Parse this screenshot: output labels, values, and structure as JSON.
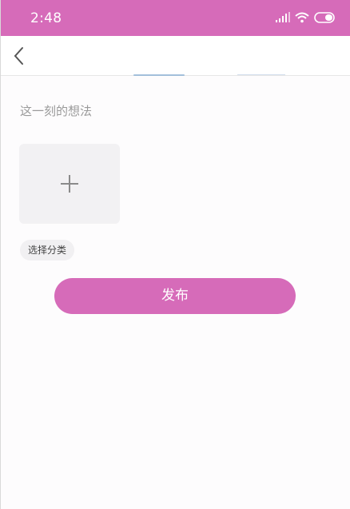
{
  "status_bar": {
    "time": "2:48",
    "background": "#d66bb9",
    "icons": [
      "signal-icon",
      "wifi-icon",
      "battery-icon"
    ]
  },
  "nav_bar": {
    "back_icon": "chevron-left-icon"
  },
  "composer": {
    "placeholder": "这一刻的想法",
    "add_photo_icon": "plus-icon",
    "category_label": "选择分类"
  },
  "actions": {
    "publish_label": "发布",
    "accent": "#d66bb9"
  }
}
